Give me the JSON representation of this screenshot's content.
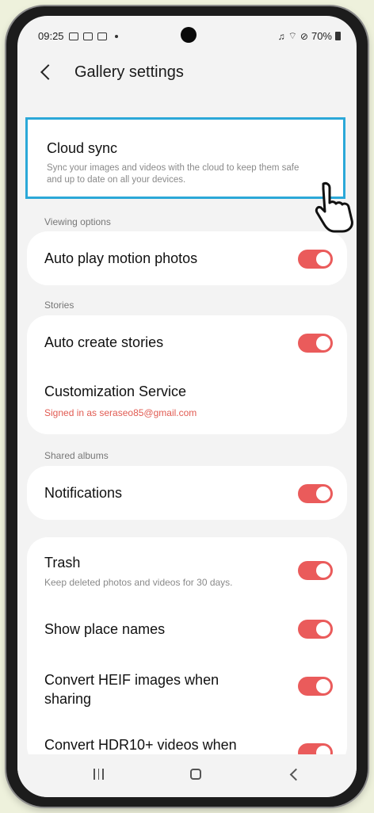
{
  "status_bar": {
    "time": "09:25",
    "battery_percent": "70%"
  },
  "header": {
    "title": "Gallery settings"
  },
  "cloud_sync": {
    "title": "Cloud sync",
    "description": "Sync your images and videos with the cloud to keep them safe and up to date on all your devices."
  },
  "sections": {
    "viewing_options": "Viewing options",
    "stories": "Stories",
    "shared_albums": "Shared albums"
  },
  "settings": {
    "auto_play": {
      "title": "Auto play motion photos",
      "enabled": true
    },
    "auto_create_stories": {
      "title": "Auto create stories",
      "enabled": true
    },
    "customization": {
      "title": "Customization Service",
      "subtitle": "Signed in as seraseo85@gmail.com"
    },
    "notifications": {
      "title": "Notifications",
      "enabled": true
    },
    "trash": {
      "title": "Trash",
      "subtitle": "Keep deleted photos and videos for 30 days.",
      "enabled": true
    },
    "show_place_names": {
      "title": "Show place names",
      "enabled": true
    },
    "convert_heif": {
      "title": "Convert HEIF images when sharing",
      "enabled": true
    },
    "convert_hdr": {
      "title": "Convert HDR10+ videos when",
      "enabled": true
    }
  },
  "colors": {
    "toggle_on": "#ea5b5b",
    "highlight_border": "#2ba8d8",
    "account_text": "#e15b52"
  },
  "icons": {
    "back": "chevron-left-icon",
    "cursor": "hand-pointer-icon"
  }
}
